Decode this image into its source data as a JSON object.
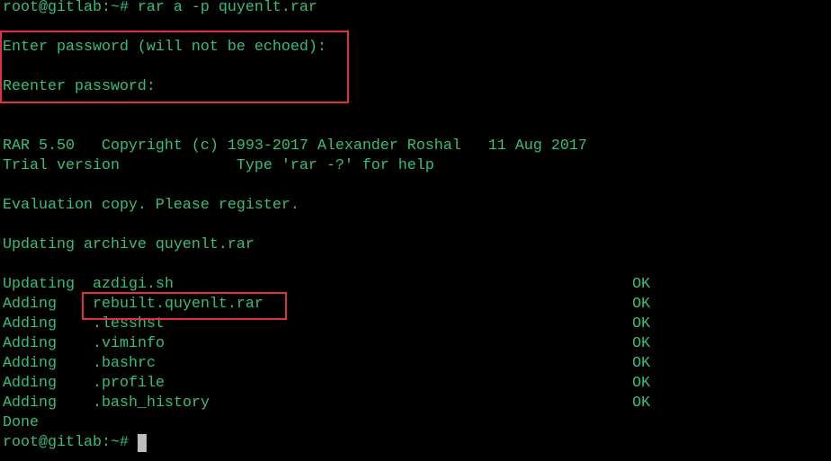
{
  "terminal": {
    "command_prompt": "root@gitlab:~# rar a -p quyenlt.rar",
    "password_prompt": "Enter password (will not be echoed):",
    "reenter_prompt": "Reenter password:",
    "banner_line1": "RAR 5.50   Copyright (c) 1993-2017 Alexander Roshal   11 Aug 2017",
    "banner_line2": "Trial version             Type 'rar -?' for help",
    "evaluation": "Evaluation copy. Please register.",
    "updating_archive": "Updating archive quyenlt.rar",
    "files": [
      {
        "action": "Updating",
        "file": "azdigi.sh",
        "status": "OK"
      },
      {
        "action": "Adding",
        "file": "rebuilt.quyenlt.rar",
        "status": "OK"
      },
      {
        "action": "Adding",
        "file": ".lesshst",
        "status": "OK"
      },
      {
        "action": "Adding",
        "file": ".viminfo",
        "status": "OK"
      },
      {
        "action": "Adding",
        "file": ".bashrc",
        "status": "OK"
      },
      {
        "action": "Adding",
        "file": ".profile",
        "status": "OK"
      },
      {
        "action": "Adding",
        "file": ".bash_history",
        "status": "OK"
      }
    ],
    "done": "Done",
    "final_prompt": "root@gitlab:~#"
  },
  "colors": {
    "text": "#37be78",
    "background": "#000000",
    "highlight_box": "#e0303c"
  }
}
